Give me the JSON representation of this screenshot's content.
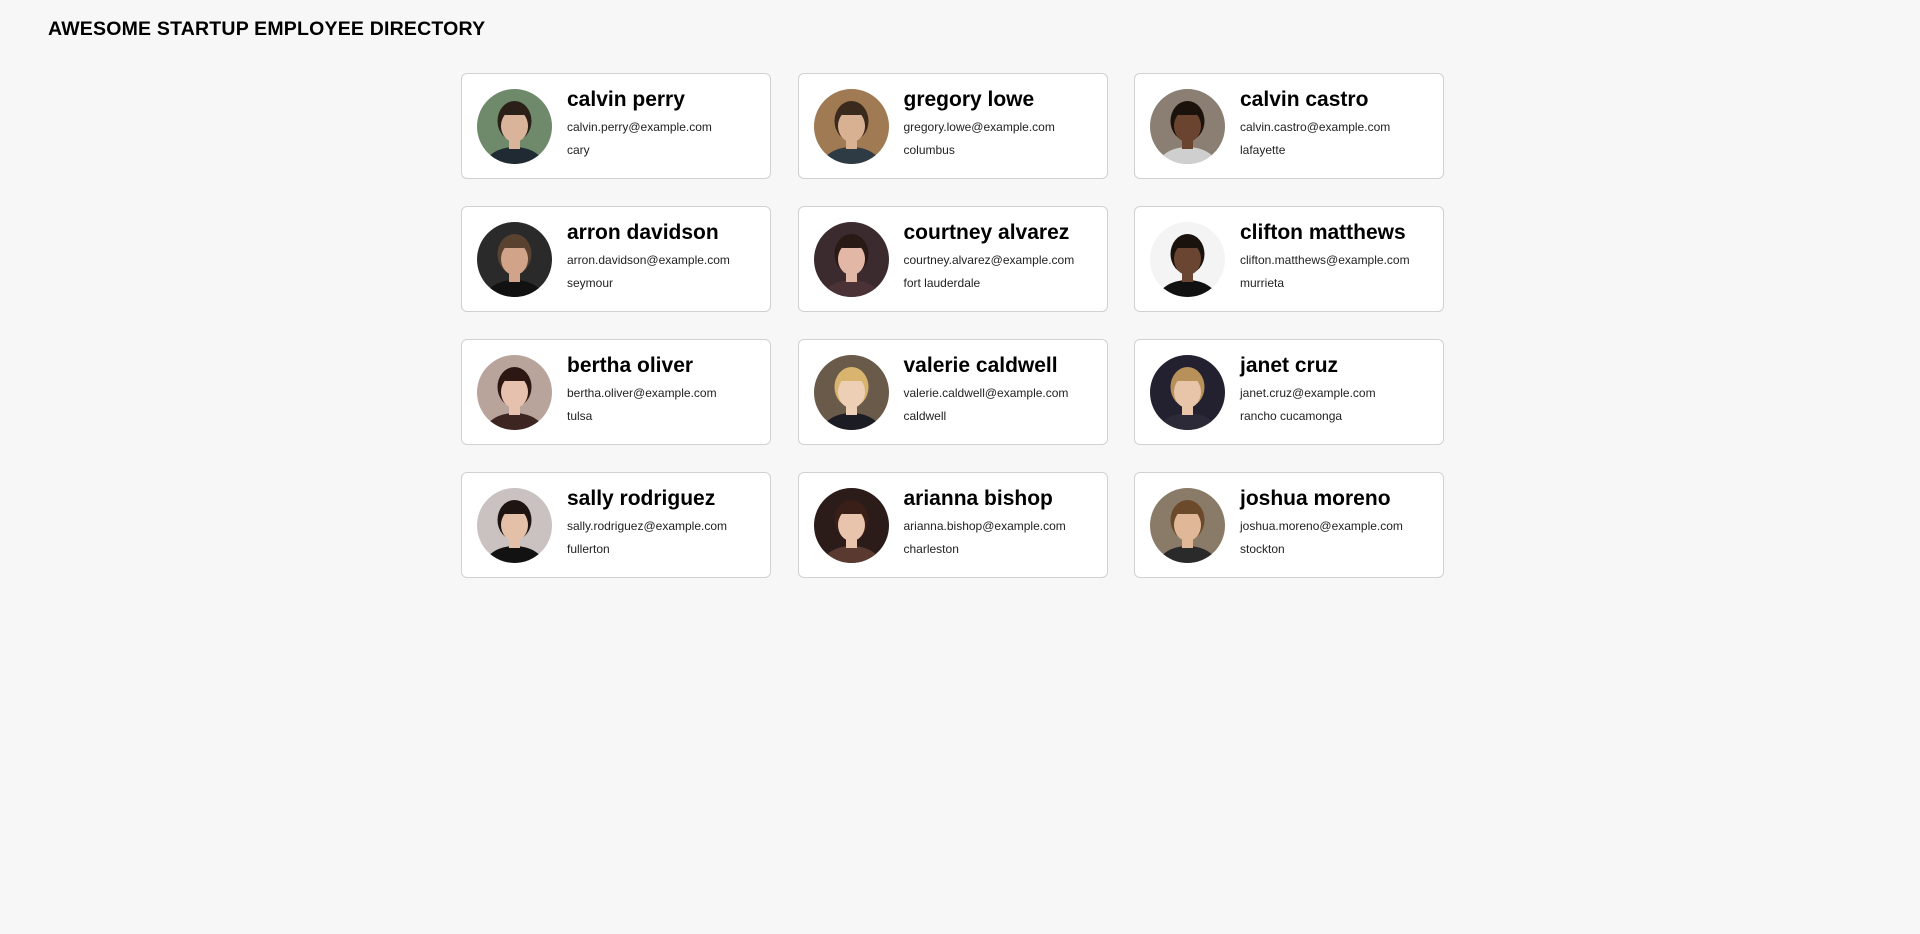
{
  "header": {
    "title": "AWESOME STARTUP EMPLOYEE DIRECTORY"
  },
  "employees": [
    {
      "name": "calvin perry",
      "email": "calvin.perry@example.com",
      "city": "cary",
      "avatar_icon": "employee-photo-icon",
      "bg": "#6f8a6a",
      "skin": "#d9b49a",
      "hair": "#2b2018",
      "shirt": "#1f2a33"
    },
    {
      "name": "gregory lowe",
      "email": "gregory.lowe@example.com",
      "city": "columbus",
      "avatar_icon": "employee-photo-icon",
      "bg": "#a07a52",
      "skin": "#d8b092",
      "hair": "#3a2a1e",
      "shirt": "#2e3a44"
    },
    {
      "name": "calvin castro",
      "email": "calvin.castro@example.com",
      "city": "lafayette",
      "avatar_icon": "employee-photo-icon",
      "bg": "#8a7f72",
      "skin": "#6b4430",
      "hair": "#1b120c",
      "shirt": "#cfcfcf"
    },
    {
      "name": "arron davidson",
      "email": "arron.davidson@example.com",
      "city": "seymour",
      "avatar_icon": "employee-photo-icon",
      "bg": "#2a2a2a",
      "skin": "#d1a48a",
      "hair": "#5a4230",
      "shirt": "#111111"
    },
    {
      "name": "courtney alvarez",
      "email": "courtney.alvarez@example.com",
      "city": "fort lauderdale",
      "avatar_icon": "employee-photo-icon",
      "bg": "#3b2b2e",
      "skin": "#e2b7a6",
      "hair": "#2a1a16",
      "shirt": "#4a3236"
    },
    {
      "name": "clifton matthews",
      "email": "clifton.matthews@example.com",
      "city": "murrieta",
      "avatar_icon": "employee-photo-icon",
      "bg": "#f4f4f4",
      "skin": "#6a4532",
      "hair": "#1a120d",
      "shirt": "#111111"
    },
    {
      "name": "bertha oliver",
      "email": "bertha.oliver@example.com",
      "city": "tulsa",
      "avatar_icon": "employee-photo-icon",
      "bg": "#b8a49a",
      "skin": "#e6c2ae",
      "hair": "#2c1713",
      "shirt": "#3d2622"
    },
    {
      "name": "valerie caldwell",
      "email": "valerie.caldwell@example.com",
      "city": "caldwell",
      "avatar_icon": "employee-photo-icon",
      "bg": "#6a5a4a",
      "skin": "#edcfb6",
      "hair": "#d8b46e",
      "shirt": "#1c1c24"
    },
    {
      "name": "janet cruz",
      "email": "janet.cruz@example.com",
      "city": "rancho cucamonga",
      "avatar_icon": "employee-photo-icon",
      "bg": "#232030",
      "skin": "#e8c4a8",
      "hair": "#b8905a",
      "shirt": "#2c2a38"
    },
    {
      "name": "sally rodriguez",
      "email": "sally.rodriguez@example.com",
      "city": "fullerton",
      "avatar_icon": "employee-photo-icon",
      "bg": "#c9c2c0",
      "skin": "#e4c0a8",
      "hair": "#1e1412",
      "shirt": "#121212"
    },
    {
      "name": "arianna bishop",
      "email": "arianna.bishop@example.com",
      "city": "charleston",
      "avatar_icon": "employee-photo-icon",
      "bg": "#2b1c1a",
      "skin": "#e7c4ab",
      "hair": "#3a1e18",
      "shirt": "#5a3a30"
    },
    {
      "name": "joshua moreno",
      "email": "joshua.moreno@example.com",
      "city": "stockton",
      "avatar_icon": "employee-photo-icon",
      "bg": "#8a7a68",
      "skin": "#e0b898",
      "hair": "#6a4a2a",
      "shirt": "#2a2a2a"
    }
  ]
}
